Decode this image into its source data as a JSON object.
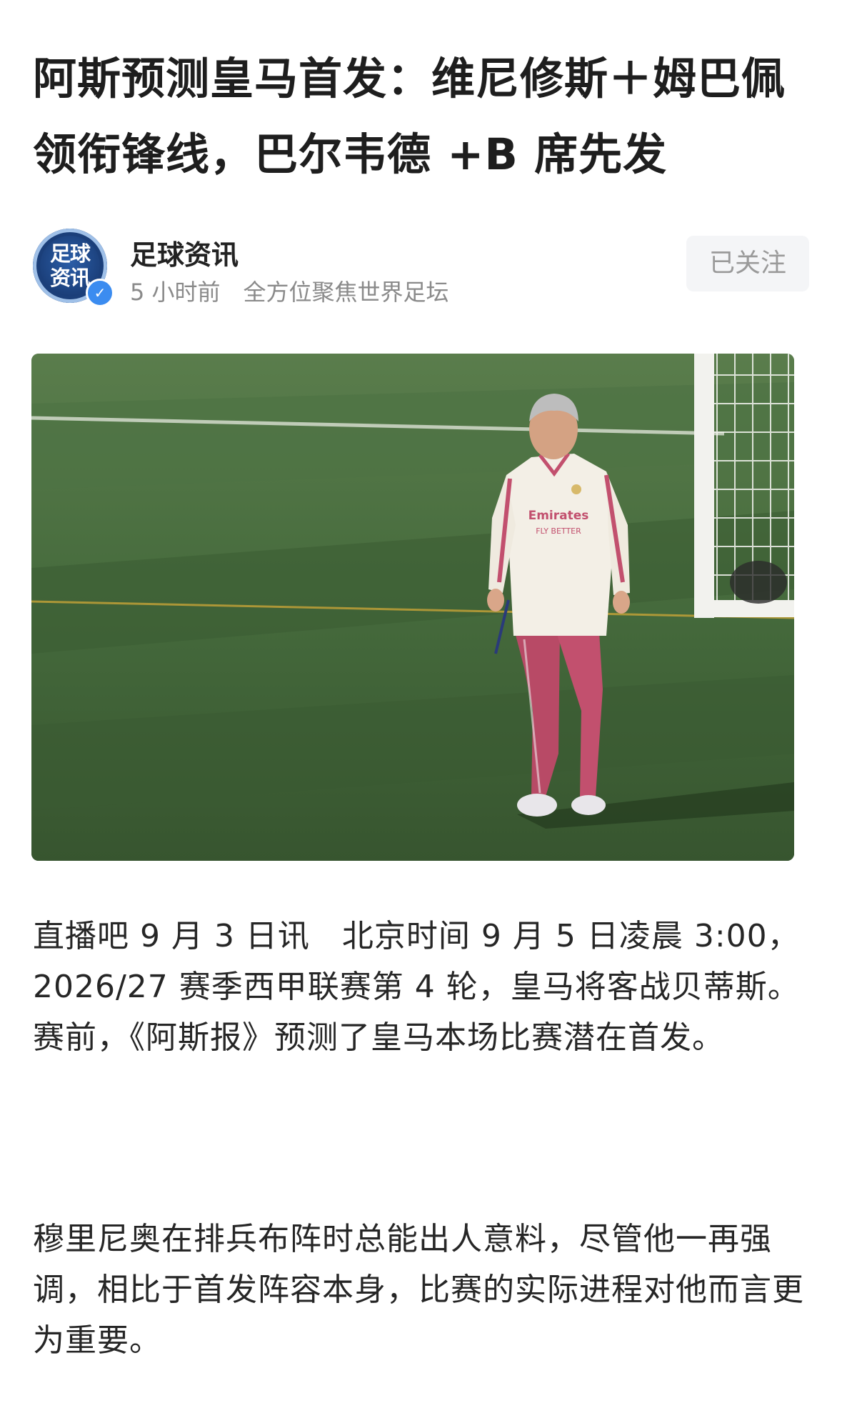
{
  "article": {
    "title": "阿斯预测皇马首发：维尼修斯＋姆巴佩领衔锋线，巴尔韦德 +B 席先发"
  },
  "author": {
    "avatar_text": "足球资讯",
    "name": "足球资讯",
    "time": "5 小时前",
    "bio": "全方位聚焦世界足坛",
    "follow_label": "已关注",
    "verified_icon": "check-badge-icon"
  },
  "photo": {
    "jersey_sponsor": "Emirates",
    "jersey_slogan": "FLY BETTER",
    "colors": {
      "grass_light": "#557a48",
      "grass_dark": "#35542f",
      "jersey": "#f3efe6",
      "trim": "#c2506e"
    }
  },
  "body": {
    "paragraphs": [
      "直播吧 9 月 3 日讯　北京时间 9 月 5 日凌晨 3:00，2026/27 赛季西甲联赛第 4 轮，皇马将客战贝蒂斯。赛前，《阿斯报》预测了皇马本场比赛潜在首发。",
      "穆里尼奥在排兵布阵时总能出人意料，尽管他一再强调，相比于首发阵容本身，比赛的实际进程对他而言更为重要。"
    ]
  }
}
